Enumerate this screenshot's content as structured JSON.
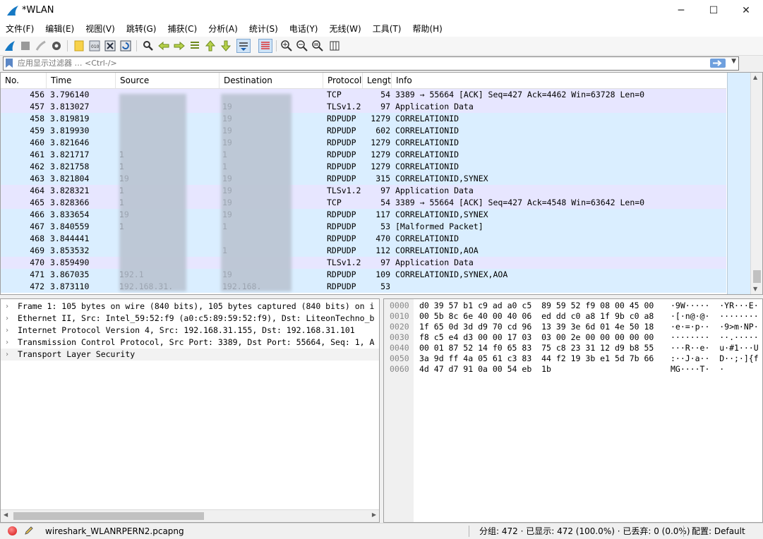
{
  "window": {
    "title": "*WLAN",
    "minimize": "─",
    "maximize": "☐",
    "close": "✕"
  },
  "menu": [
    "文件(F)",
    "编辑(E)",
    "视图(V)",
    "跳转(G)",
    "捕获(C)",
    "分析(A)",
    "统计(S)",
    "电话(Y)",
    "无线(W)",
    "工具(T)",
    "帮助(H)"
  ],
  "filter": {
    "placeholder": "应用显示过滤器 … <Ctrl-/>",
    "value": "",
    "plus": "+"
  },
  "columns": [
    "No.",
    "Time",
    "Source",
    "Destination",
    "Protocol",
    "Length",
    "Info"
  ],
  "colors": {
    "tcp": "#e7e6ff",
    "udp": "#daeeff",
    "accent": "#6fa0de"
  },
  "packets": [
    {
      "no": "456",
      "time": "3.796140",
      "src": "",
      "dst": "",
      "proto": "TCP",
      "len": "54",
      "info": "3389 → 55664 [ACK] Seq=427 Ack=4462 Win=63728 Len=0",
      "color": "tcp"
    },
    {
      "no": "457",
      "time": "3.813027",
      "src": "",
      "dst": "19",
      "proto": "TLSv1.2",
      "len": "97",
      "info": "Application Data",
      "color": "tcp"
    },
    {
      "no": "458",
      "time": "3.819819",
      "src": "",
      "dst": "19",
      "proto": "RDPUDP",
      "len": "1279",
      "info": "CORRELATIONID",
      "color": "udp"
    },
    {
      "no": "459",
      "time": "3.819930",
      "src": "",
      "dst": "19",
      "proto": "RDPUDP",
      "len": "602",
      "info": "CORRELATIONID",
      "color": "udp"
    },
    {
      "no": "460",
      "time": "3.821646",
      "src": "",
      "dst": "19",
      "proto": "RDPUDP",
      "len": "1279",
      "info": "CORRELATIONID",
      "color": "udp"
    },
    {
      "no": "461",
      "time": "3.821717",
      "src": "1",
      "dst": "1",
      "proto": "RDPUDP",
      "len": "1279",
      "info": "CORRELATIONID",
      "color": "udp"
    },
    {
      "no": "462",
      "time": "3.821758",
      "src": "1",
      "dst": "1",
      "proto": "RDPUDP",
      "len": "1279",
      "info": "CORRELATIONID",
      "color": "udp"
    },
    {
      "no": "463",
      "time": "3.821804",
      "src": "19",
      "dst": "19",
      "proto": "RDPUDP",
      "len": "315",
      "info": "CORRELATIONID,SYNEX",
      "color": "udp"
    },
    {
      "no": "464",
      "time": "3.828321",
      "src": "1",
      "dst": "19",
      "proto": "TLSv1.2",
      "len": "97",
      "info": "Application Data",
      "color": "tcp"
    },
    {
      "no": "465",
      "time": "3.828366",
      "src": "1",
      "dst": "19",
      "proto": "TCP",
      "len": "54",
      "info": "3389 → 55664 [ACK] Seq=427 Ack=4548 Win=63642 Len=0",
      "color": "tcp"
    },
    {
      "no": "466",
      "time": "3.833654",
      "src": "19",
      "dst": "19",
      "proto": "RDPUDP",
      "len": "117",
      "info": "CORRELATIONID,SYNEX",
      "color": "udp"
    },
    {
      "no": "467",
      "time": "3.840559",
      "src": "1",
      "dst": "1",
      "proto": "RDPUDP",
      "len": "53",
      "info": "[Malformed Packet]",
      "color": "udp"
    },
    {
      "no": "468",
      "time": "3.844441",
      "src": "",
      "dst": "",
      "proto": "RDPUDP",
      "len": "470",
      "info": "CORRELATIONID",
      "color": "udp"
    },
    {
      "no": "469",
      "time": "3.853532",
      "src": "",
      "dst": "1",
      "proto": "RDPUDP",
      "len": "112",
      "info": "CORRELATIONID,AOA",
      "color": "udp"
    },
    {
      "no": "470",
      "time": "3.859490",
      "src": "",
      "dst": "",
      "proto": "TLSv1.2",
      "len": "97",
      "info": "Application Data",
      "color": "tcp"
    },
    {
      "no": "471",
      "time": "3.867035",
      "src": "192.1",
      "dst": "19",
      "proto": "RDPUDP",
      "len": "109",
      "info": "CORRELATIONID,SYNEX,AOA",
      "color": "udp"
    },
    {
      "no": "472",
      "time": "3.873110",
      "src": "192.168.31.",
      "dst": "192.168.",
      "proto": "RDPUDP",
      "len": "53",
      "info": "",
      "color": "udp"
    }
  ],
  "details": [
    "Frame 1: 105 bytes on wire (840 bits), 105 bytes captured (840 bits) on i",
    "Ethernet II, Src: Intel_59:52:f9 (a0:c5:89:59:52:f9), Dst: LiteonTechno_b",
    "Internet Protocol Version 4, Src: 192.168.31.155, Dst: 192.168.31.101",
    "Transmission Control Protocol, Src Port: 3389, Dst Port: 55664, Seq: 1, A",
    "Transport Layer Security"
  ],
  "hexdump": [
    {
      "off": "0000",
      "hex": "d0 39 57 b1 c9 ad a0 c5  89 59 52 f9 08 00 45 00",
      "ascii": "·9W·····  ·YR···E·"
    },
    {
      "off": "0010",
      "hex": "00 5b 8c 6e 40 00 40 06  ed dd c0 a8 1f 9b c0 a8",
      "ascii": "·[·n@·@·  ········"
    },
    {
      "off": "0020",
      "hex": "1f 65 0d 3d d9 70 cd 96  13 39 3e 6d 01 4e 50 18",
      "ascii": "·e·=·p··  ·9>m·NP·"
    },
    {
      "off": "0030",
      "hex": "f8 c5 e4 d3 00 00 17 03  03 00 2e 00 00 00 00 00",
      "ascii": "········  ··.·····"
    },
    {
      "off": "0040",
      "hex": "00 01 87 52 14 f0 65 83  75 c8 23 31 12 d9 b8 55",
      "ascii": "···R··e·  u·#1···U"
    },
    {
      "off": "0050",
      "hex": "3a 9d ff 4a 05 61 c3 83  44 f2 19 3b e1 5d 7b 66",
      "ascii": ":··J·a··  D··;·]{f"
    },
    {
      "off": "0060",
      "hex": "4d 47 d7 91 0a 00 54 eb  1b",
      "ascii": "MG····T·  ·"
    }
  ],
  "status": {
    "file": "wireshark_WLANRPERN2.pcapng",
    "counts": "分组: 472 · 已显示: 472 (100.0%) · 已丢弃: 0 (0.0%)",
    "profile": "配置: Default"
  }
}
